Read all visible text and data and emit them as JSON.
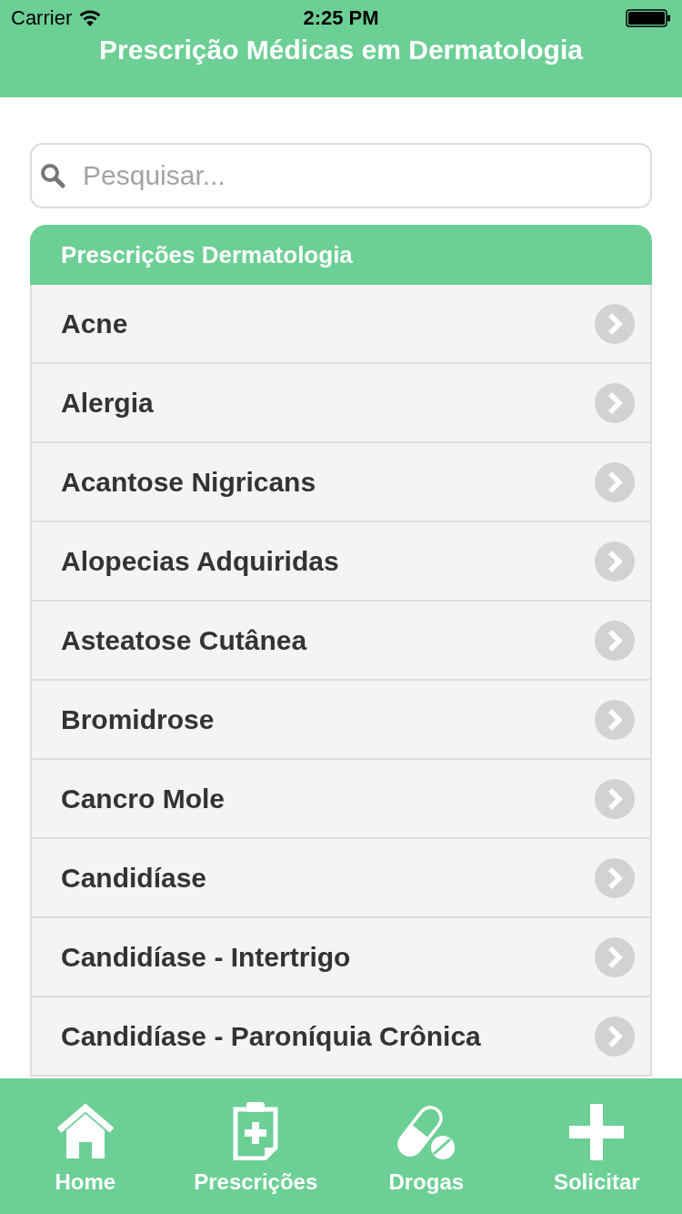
{
  "status_bar": {
    "carrier": "Carrier",
    "time": "2:25 PM"
  },
  "nav_bar": {
    "title": "Prescrição Médicas em Dermatologia"
  },
  "search": {
    "placeholder": "Pesquisar..."
  },
  "list": {
    "header": "Prescrições Dermatologia",
    "items": [
      {
        "label": "Acne"
      },
      {
        "label": "Alergia"
      },
      {
        "label": "Acantose Nigricans"
      },
      {
        "label": "Alopecias Adquiridas"
      },
      {
        "label": "Asteatose Cutânea"
      },
      {
        "label": "Bromidrose"
      },
      {
        "label": "Cancro Mole"
      },
      {
        "label": "Candidíase"
      },
      {
        "label": "Candidíase - Intertrigo"
      },
      {
        "label": "Candidíase - Paroníquia Crônica"
      }
    ]
  },
  "tab_bar": {
    "items": [
      {
        "kind": "home",
        "label": "Home"
      },
      {
        "kind": "prescriptions",
        "label": "Prescrições"
      },
      {
        "kind": "drugs",
        "label": "Drogas"
      },
      {
        "kind": "request",
        "label": "Solicitar"
      }
    ]
  }
}
